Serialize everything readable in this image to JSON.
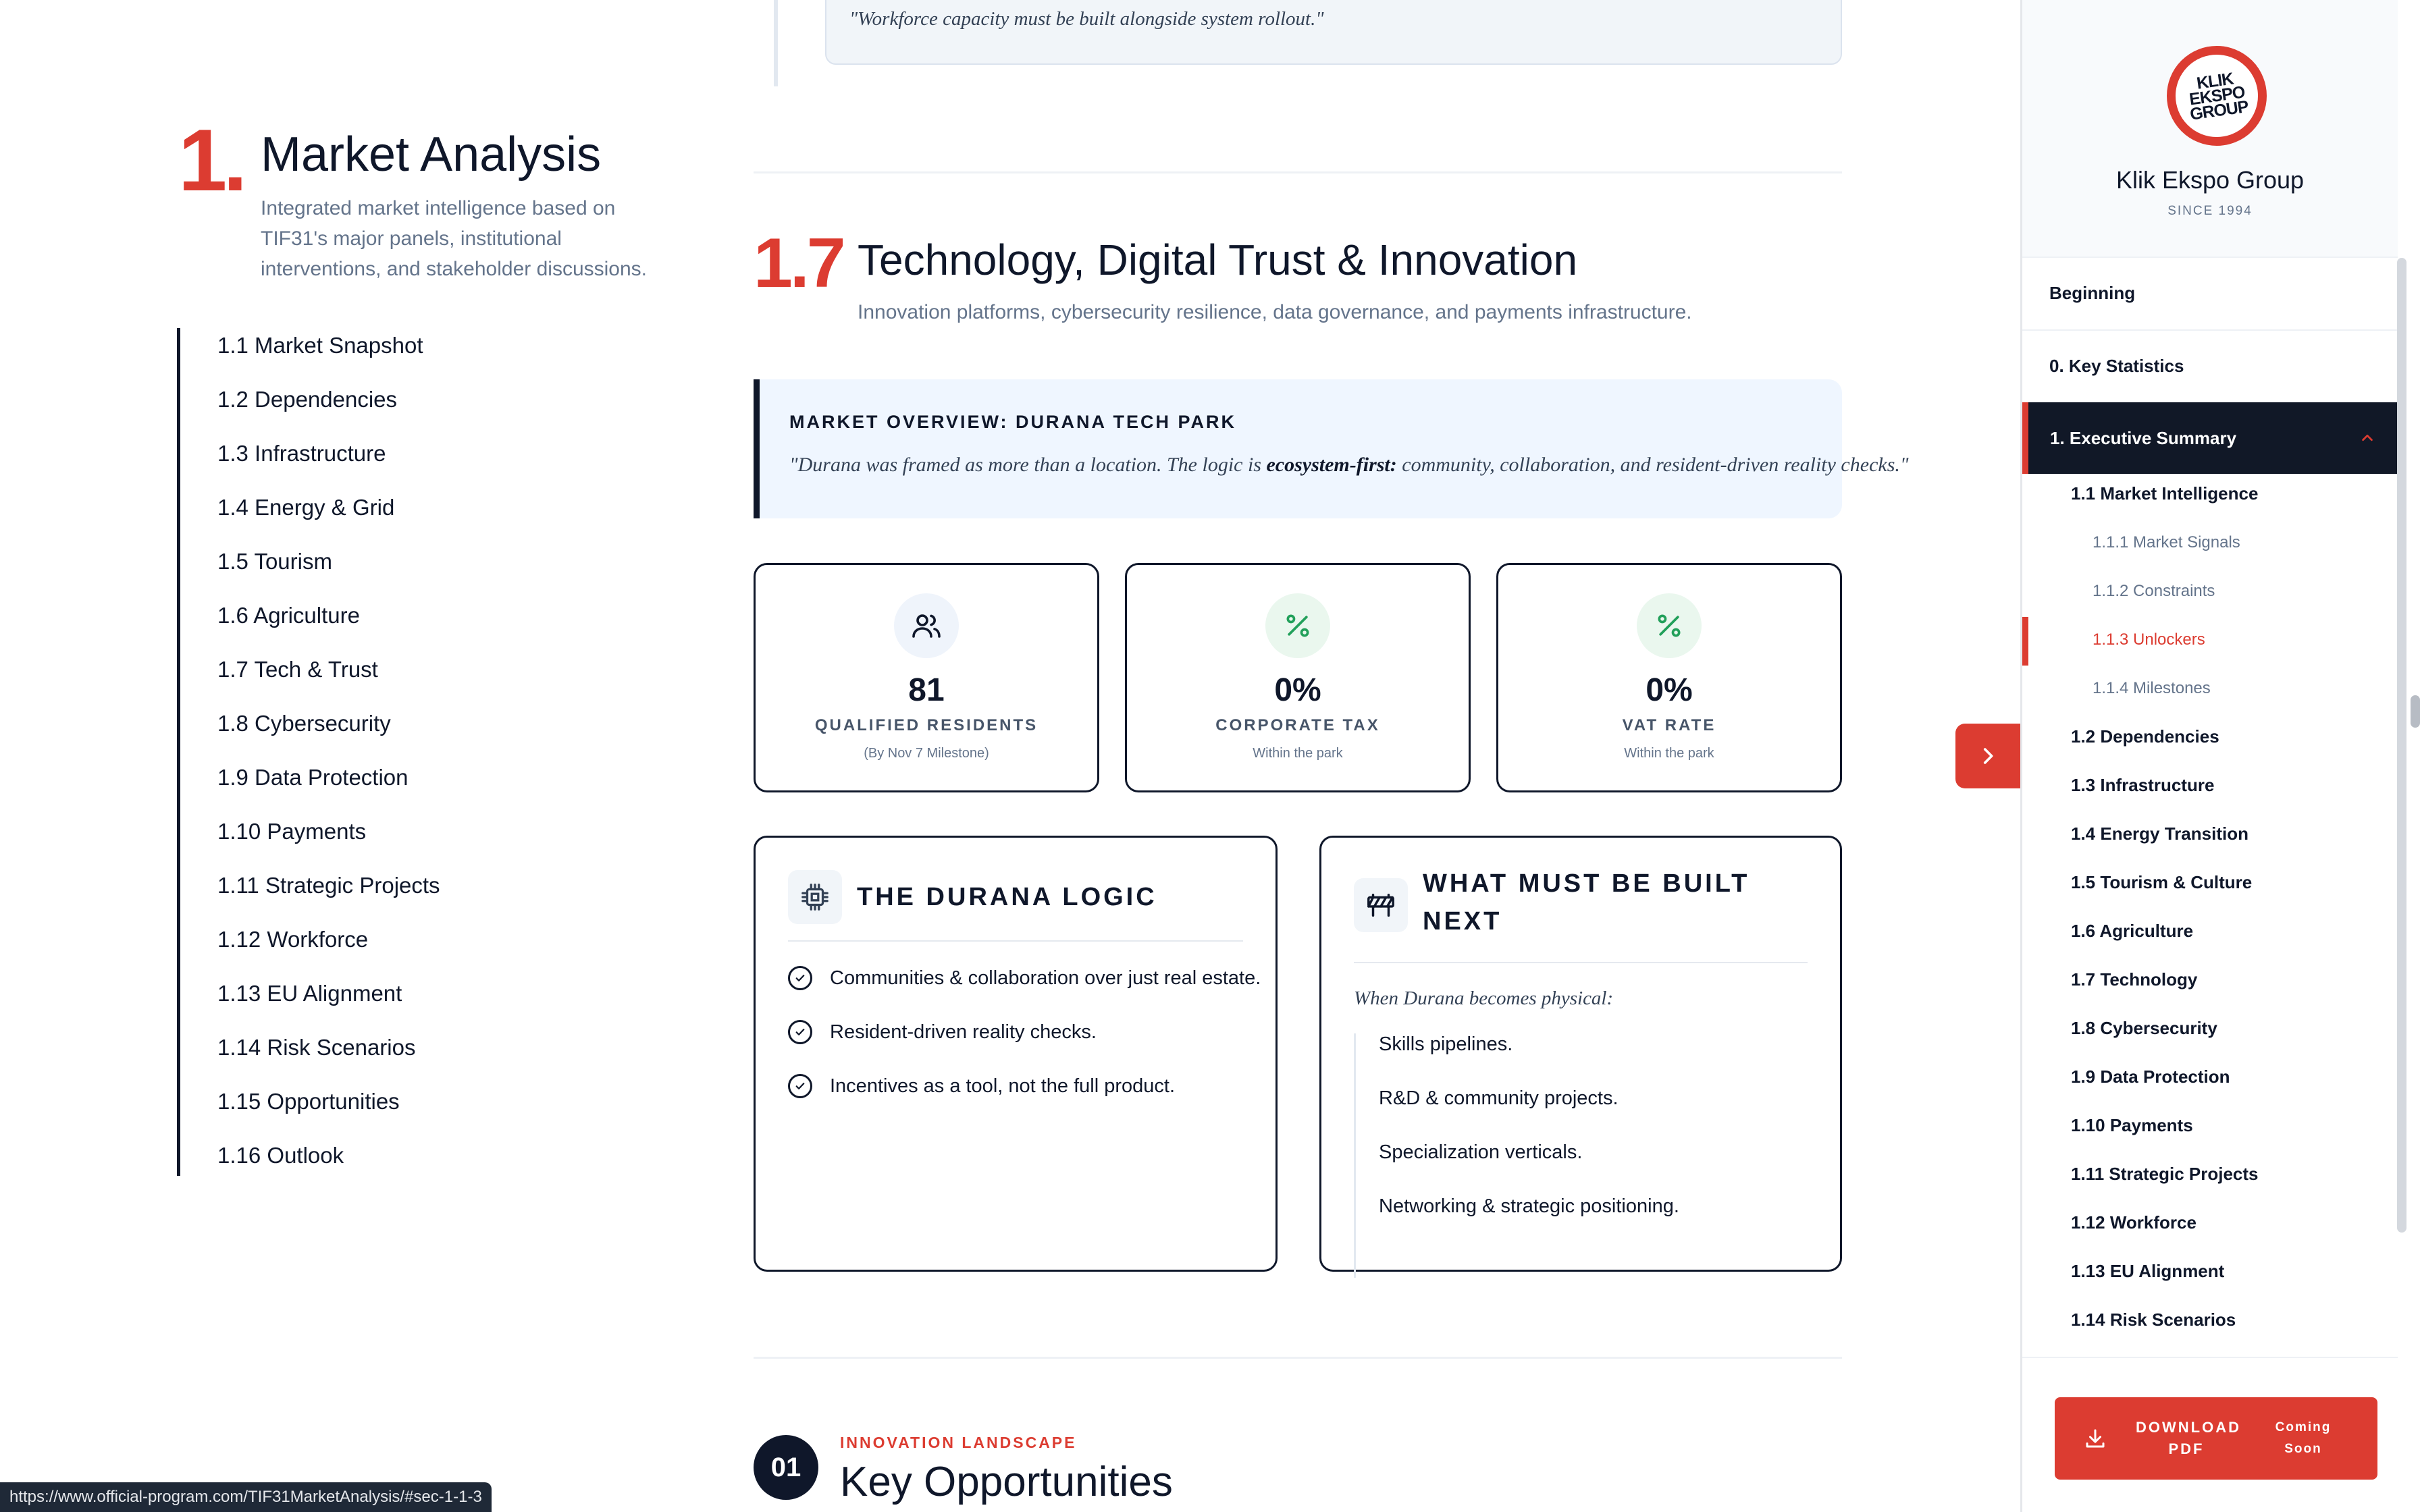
{
  "top_quote": "\"Workforce capacity must be built alongside system rollout.\"",
  "section": {
    "number": "1.",
    "title": "Market Analysis",
    "subtitle": "Integrated market intelligence based on TIF31's major panels, institutional interventions, and stakeholder discussions."
  },
  "toc": [
    "1.1 Market Snapshot",
    "1.2 Dependencies",
    "1.3 Infrastructure",
    "1.4 Energy & Grid",
    "1.5 Tourism",
    "1.6 Agriculture",
    "1.7 Tech & Trust",
    "1.8 Cybersecurity",
    "1.9 Data Protection",
    "1.10 Payments",
    "1.11 Strategic Projects",
    "1.12 Workforce",
    "1.13 EU Alignment",
    "1.14 Risk Scenarios",
    "1.15 Opportunities",
    "1.16 Outlook"
  ],
  "heading": {
    "number": "1.7",
    "title": "Technology, Digital Trust & Innovation",
    "subtitle": "Innovation platforms, cybersecurity resilience, data governance, and payments infrastructure."
  },
  "overview": {
    "label": "MARKET OVERVIEW: DURANA TECH PARK",
    "quote_before": "\"Durana was framed as more than a location. The logic is ",
    "quote_bold": "ecosystem-first:",
    "quote_after": " community, collaboration, and resident-driven reality checks.\""
  },
  "stats": [
    {
      "icon": "users-icon",
      "value": "81",
      "label": "QUALIFIED RESIDENTS",
      "note": "(By Nov 7 Milestone)"
    },
    {
      "icon": "percent-icon",
      "value": "0%",
      "label": "CORPORATE TAX",
      "note": "Within the park"
    },
    {
      "icon": "percent-icon",
      "value": "0%",
      "label": "VAT RATE",
      "note": "Within the park"
    }
  ],
  "logic_card": {
    "title": "THE DURANA LOGIC",
    "items": [
      "Communities & collaboration over just real estate.",
      "Resident-driven reality checks.",
      "Incentives as a tool, not the full product."
    ]
  },
  "built_card": {
    "title_line1": "WHAT MUST BE BUILT",
    "title_line2": "NEXT",
    "intro": "When Durana becomes physical:",
    "items": [
      "Skills pipelines.",
      "R&D & community projects.",
      "Specialization verticals.",
      "Networking & strategic positioning."
    ]
  },
  "next_section": {
    "badge": "01",
    "label": "INNOVATION LANDSCAPE",
    "title": "Key Opportunities"
  },
  "status_url": "https://www.official-program.com/TIF31MarketAnalysis/#sec-1-1-3",
  "sidebar": {
    "logo_text_1": "KLIK",
    "logo_text_2": "EKSPO",
    "logo_text_3": "GROUP",
    "brand": "Klik Ekspo Group",
    "since": "SINCE 1994",
    "nav_top": [
      "Beginning",
      "0. Key Statistics"
    ],
    "nav_active": "1. Executive Summary",
    "sub_items": [
      {
        "label": "1.1 Market Intelligence",
        "level": 1
      },
      {
        "label": "1.1.1 Market Signals",
        "level": 2
      },
      {
        "label": "1.1.2 Constraints",
        "level": 2
      },
      {
        "label": "1.1.3 Unlockers",
        "level": 2,
        "active": true
      },
      {
        "label": "1.1.4 Milestones",
        "level": 2
      },
      {
        "label": "1.2 Dependencies",
        "level": 1
      },
      {
        "label": "1.3 Infrastructure",
        "level": 1
      },
      {
        "label": "1.4 Energy Transition",
        "level": 1
      },
      {
        "label": "1.5 Tourism & Culture",
        "level": 1
      },
      {
        "label": "1.6 Agriculture",
        "level": 1
      },
      {
        "label": "1.7 Technology",
        "level": 1
      },
      {
        "label": "1.8 Cybersecurity",
        "level": 1
      },
      {
        "label": "1.9 Data Protection",
        "level": 1
      },
      {
        "label": "1.10 Payments",
        "level": 1
      },
      {
        "label": "1.11 Strategic Projects",
        "level": 1
      },
      {
        "label": "1.12 Workforce",
        "level": 1
      },
      {
        "label": "1.13 EU Alignment",
        "level": 1
      },
      {
        "label": "1.14 Risk Scenarios",
        "level": 1
      }
    ],
    "download_label": "DOWNLOAD PDF",
    "download_status": "Coming Soon"
  },
  "colors": {
    "accent": "#dc3c31",
    "dark": "#0f172a",
    "muted": "#64748b"
  }
}
